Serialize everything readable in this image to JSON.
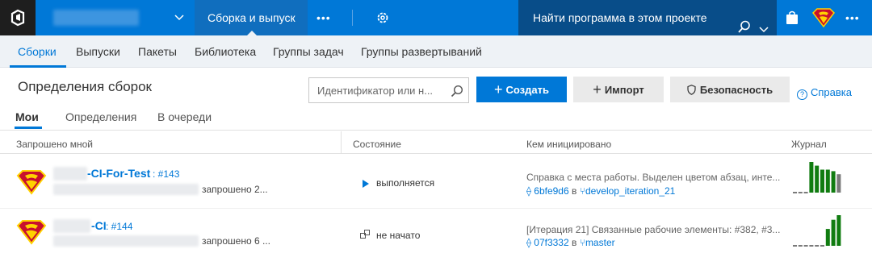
{
  "topbar": {
    "hub_title": "Сборка и выпуск",
    "more_label": "•••",
    "search_placeholder": "Найти программа в этом проекте",
    "more_right": "•••"
  },
  "subnav": {
    "items": [
      "Сборки",
      "Выпуски",
      "Пакеты",
      "Библиотека",
      "Группы задач",
      "Группы развертываний"
    ]
  },
  "page": {
    "title": "Определения сборок",
    "search_placeholder": "Идентификатор или н...",
    "create_label": "Создать",
    "import_label": "Импорт",
    "security_label": "Безопасность",
    "help_label": "Справка"
  },
  "tabs": [
    "Мои",
    "Определения",
    "В очереди"
  ],
  "columns": {
    "requested": "Запрошено мной",
    "state": "Состояние",
    "triggered": "Кем инициировано",
    "history": "Журнал"
  },
  "rows": [
    {
      "definition": "-CI-For-Test",
      "build_number": ": #143",
      "requested": "запрошено 2...",
      "state": "выполняется",
      "message": "Справка с места работы. Выделен цветом абзац, инте...",
      "commit": "6bfe9d6",
      "in_label": "в",
      "branch": "develop_iteration_21",
      "history": [
        0,
        0,
        0,
        1,
        0.88,
        0.75,
        0.75,
        0.7,
        0.6
      ]
    },
    {
      "definition": "-CI",
      "build_number": ": #144",
      "requested": "запрошено 6 ...",
      "state": "не начато",
      "message": "[Итерация 21] Связанные рабочие элементы: #382, #3...",
      "commit": "07f3332",
      "in_label": "в",
      "branch": "master",
      "history": [
        0,
        0,
        0,
        0,
        0,
        0,
        0.55,
        0.85,
        1
      ]
    }
  ],
  "colors": {
    "accent": "#0078d7",
    "success": "#107c10",
    "neutral": "#7a7a7a"
  }
}
